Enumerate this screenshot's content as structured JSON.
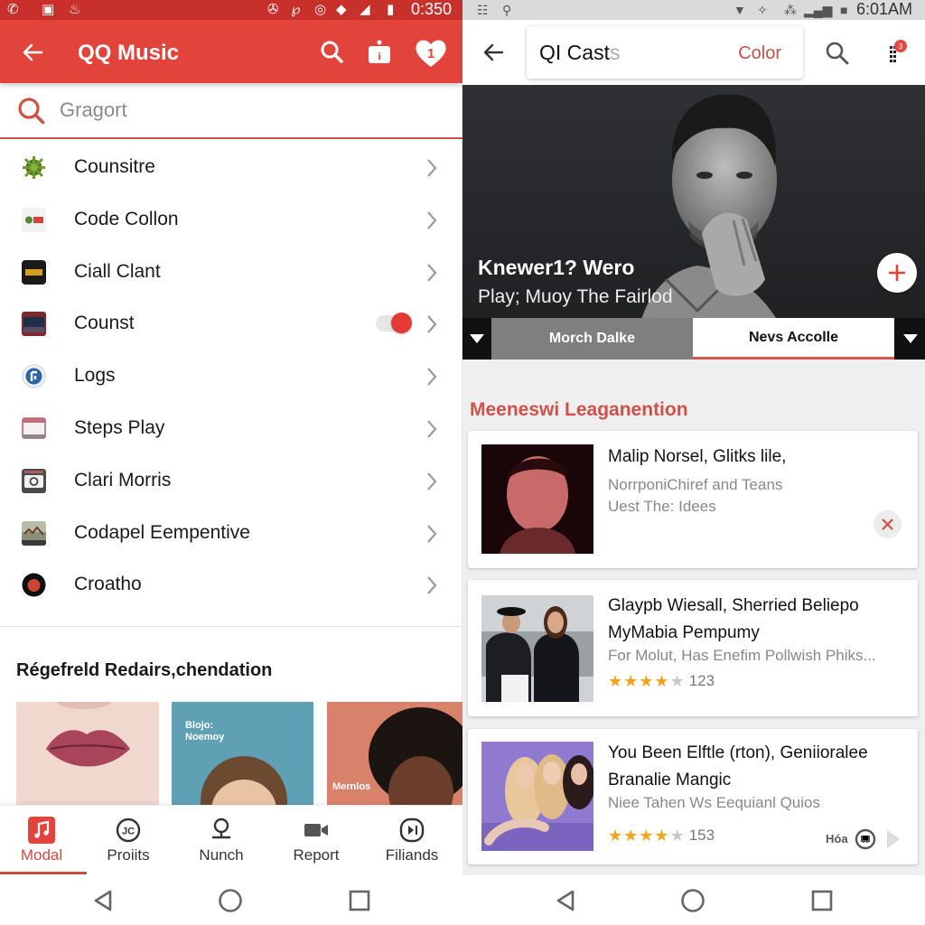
{
  "left_panel": {
    "status_bar": {
      "time": "0:350",
      "icons": [
        "notification-icon-a",
        "sim-icon",
        "notification-icon-b",
        "alarm-icon",
        "sync-icon",
        "target-icon",
        "wifi-icon",
        "signal-icon",
        "battery-icon"
      ]
    },
    "app_bar": {
      "title": "QQ Music",
      "actions": [
        "search-icon",
        "info-bag-icon",
        "heart-badge-icon"
      ],
      "heart_badge": "1"
    },
    "search": {
      "placeholder": "Gragort",
      "value": ""
    },
    "list_items": [
      {
        "label": "Counsitre",
        "icon": "green-plant-icon",
        "toggle": null
      },
      {
        "label": "Code Collon",
        "icon": "code-badge-icon",
        "toggle": null
      },
      {
        "label": "Ciall Clant",
        "icon": "dark-app-icon",
        "toggle": null
      },
      {
        "label": "Counst",
        "icon": "photo-thumb-icon",
        "toggle": true
      },
      {
        "label": "Logs",
        "icon": "blue-circle-logo-icon",
        "toggle": null
      },
      {
        "label": "Steps Play",
        "icon": "browser-window-icon",
        "toggle": null
      },
      {
        "label": "Clari Morris",
        "icon": "camera-app-icon",
        "toggle": null
      },
      {
        "label": "Codapel Eempentive",
        "icon": "landscape-thumb-icon",
        "toggle": null
      },
      {
        "label": "Croatho",
        "icon": "red-orb-icon",
        "toggle": null
      }
    ],
    "recommendations": {
      "title": "Régefreld Redairs,chendation",
      "tiles": [
        {
          "caption": "",
          "colors": {
            "bg": "#f1d9d2",
            "accent": "#a8455a"
          }
        },
        {
          "caption_line1": "Blojo:",
          "caption_line2": "Noemoy",
          "colors": {
            "bg": "#5fa0b5",
            "accent": "#6b4a30"
          }
        },
        {
          "caption": "Mernlos",
          "colors": {
            "bg": "#d9826b",
            "accent": "#1c1410"
          }
        }
      ]
    },
    "bottom_tabs": [
      {
        "label": "Modal",
        "icon": "music-note-icon",
        "active": true
      },
      {
        "label": "Proiits",
        "icon": "circle-badge-icon",
        "active": false
      },
      {
        "label": "Nunch",
        "icon": "person-pin-icon",
        "active": false
      },
      {
        "label": "Report",
        "icon": "video-camera-icon",
        "active": false
      },
      {
        "label": "Filiands",
        "icon": "play-circle-icon",
        "active": false
      }
    ]
  },
  "right_panel": {
    "status_bar": {
      "time": "6:01AM",
      "icons": [
        "notification-icon-c",
        "notification-icon-d",
        "wifi-icon",
        "bluetooth-icon",
        "vibrate-icon",
        "signal-icon",
        "battery-icon"
      ]
    },
    "app_bar": {
      "search_value": "QI Cast",
      "search_ghost": "s",
      "color_button": "Color",
      "menu_badge": "3"
    },
    "hero": {
      "title": "Knewer1? Wero",
      "subtitle": "Play; Muoy The Fairlod",
      "tabs": [
        {
          "label": "Morch Dalke",
          "active": false
        },
        {
          "label": "Nevs Accolle",
          "active": true
        }
      ]
    },
    "section_title": "Meeneswi Leaganention",
    "cards": [
      {
        "title": "Malip Norsel, Glitks lile,",
        "subtitle_lines": [
          "NorrponiChiref and Teans",
          "Uest The: Idees"
        ],
        "rating": null,
        "count": null,
        "dismissible": true,
        "thumb_colors": {
          "bg": "#1a0508",
          "accent": "#c86a6a"
        }
      },
      {
        "title": "Glaypb Wiesall, Sherried Beliepo",
        "title_line2": "MyMabia Pempumy",
        "subtitle_lines": [
          "For Molut, Has Enefim Pollwish Phiks..."
        ],
        "rating": 4,
        "rating_max": 5,
        "count": "123",
        "dismissible": false,
        "thumb_colors": {
          "bg": "#c9cdd0",
          "accent": "#1d1e24"
        }
      },
      {
        "title": "You Been Elftle (rton), Geniioralee",
        "title_line2": "Branalie Mangic",
        "subtitle_lines": [
          "Niee Tahen Ws Eequianl Quios"
        ],
        "rating": 4,
        "rating_max": 5,
        "count": "153",
        "extra_label": "Hóa",
        "dismissible": false,
        "thumb_colors": {
          "bg": "#8f7ad0",
          "accent": "#e8c79a"
        }
      }
    ]
  },
  "colors": {
    "brand_red": "#e2443c",
    "status_red": "#c8302b",
    "accent_text_red": "#d0504a",
    "star_gold": "#f2a51a",
    "star_empty": "#c8c8c8"
  }
}
